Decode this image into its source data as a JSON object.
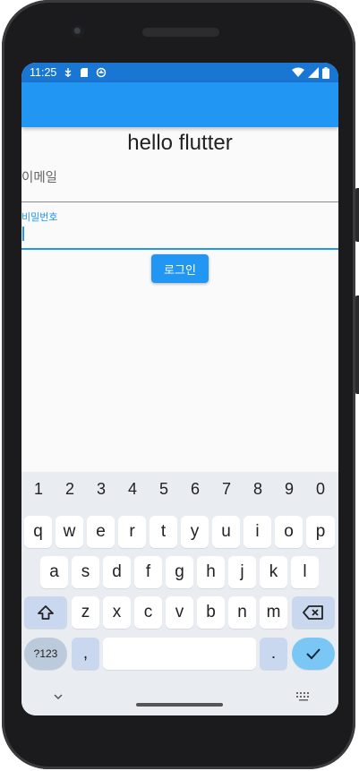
{
  "status": {
    "time": "11:25",
    "left_icons": [
      "usb-debug-icon",
      "sd-card-icon",
      "sync-icon"
    ],
    "right_icons": [
      "wifi-icon",
      "signal-icon",
      "battery-icon"
    ]
  },
  "colors": {
    "status_bar": "#1976d2",
    "app_bar": "#2196f3",
    "accent": "#2196f3"
  },
  "page": {
    "title": "hello flutter",
    "email_label": "이메일",
    "password_label": "비밀번호",
    "login_button": "로그인"
  },
  "keyboard": {
    "numbers": [
      "1",
      "2",
      "3",
      "4",
      "5",
      "6",
      "7",
      "8",
      "9",
      "0"
    ],
    "row1": [
      "q",
      "w",
      "e",
      "r",
      "t",
      "y",
      "u",
      "i",
      "o",
      "p"
    ],
    "row2": [
      "a",
      "s",
      "d",
      "f",
      "g",
      "h",
      "j",
      "k",
      "l"
    ],
    "row3": [
      "z",
      "x",
      "c",
      "v",
      "b",
      "n",
      "m"
    ],
    "symbols_key": "?123",
    "comma_key": ",",
    "period_key": "."
  }
}
